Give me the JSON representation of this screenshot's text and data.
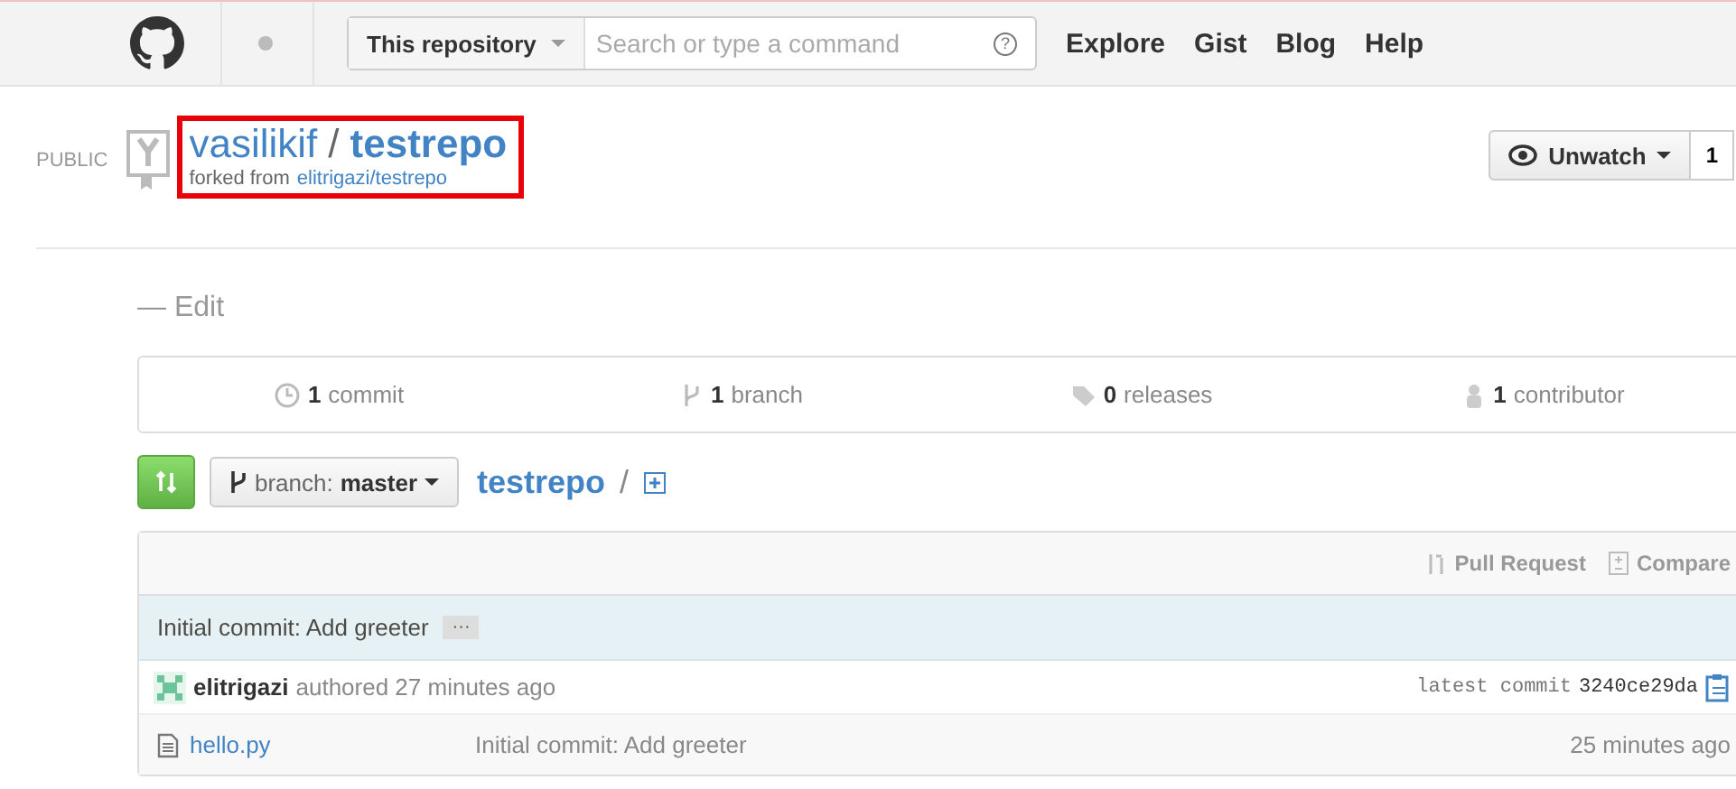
{
  "header": {
    "scope": "This repository",
    "search": {
      "placeholder": "Search or type a command"
    },
    "help_icon_label": "?",
    "nav": [
      "Explore",
      "Gist",
      "Blog",
      "Help"
    ]
  },
  "repo": {
    "visibility": "PUBLIC",
    "owner": "vasilikif",
    "separator": "/",
    "name": "testrepo",
    "fork_note": "forked from",
    "fork_source": "elitrigazi/testrepo",
    "highlighted": true
  },
  "watch": {
    "label": "Unwatch",
    "count": "1"
  },
  "description": "— Edit",
  "stats": [
    {
      "kind": "commit",
      "count": "1",
      "label": "commit"
    },
    {
      "kind": "branch",
      "count": "1",
      "label": "branch"
    },
    {
      "kind": "tag",
      "count": "0",
      "label": "releases"
    },
    {
      "kind": "people",
      "count": "1",
      "label": "contributor"
    }
  ],
  "toolbar": {
    "branch_prefix": "branch:",
    "branch": "master",
    "repo": "testrepo",
    "separator": "/"
  },
  "file_table": {
    "actions": [
      "Pull Request",
      "Compare"
    ],
    "commit_message": "Initial commit: Add greeter",
    "ellipsis": "···",
    "author": "elitrigazi",
    "authored": "authored 27 minutes ago",
    "latest_label": "latest commit",
    "sha": "3240ce29da",
    "files": [
      {
        "name": "hello.py",
        "message": "Initial commit: Add greeter",
        "age": "25 minutes ago"
      }
    ]
  }
}
